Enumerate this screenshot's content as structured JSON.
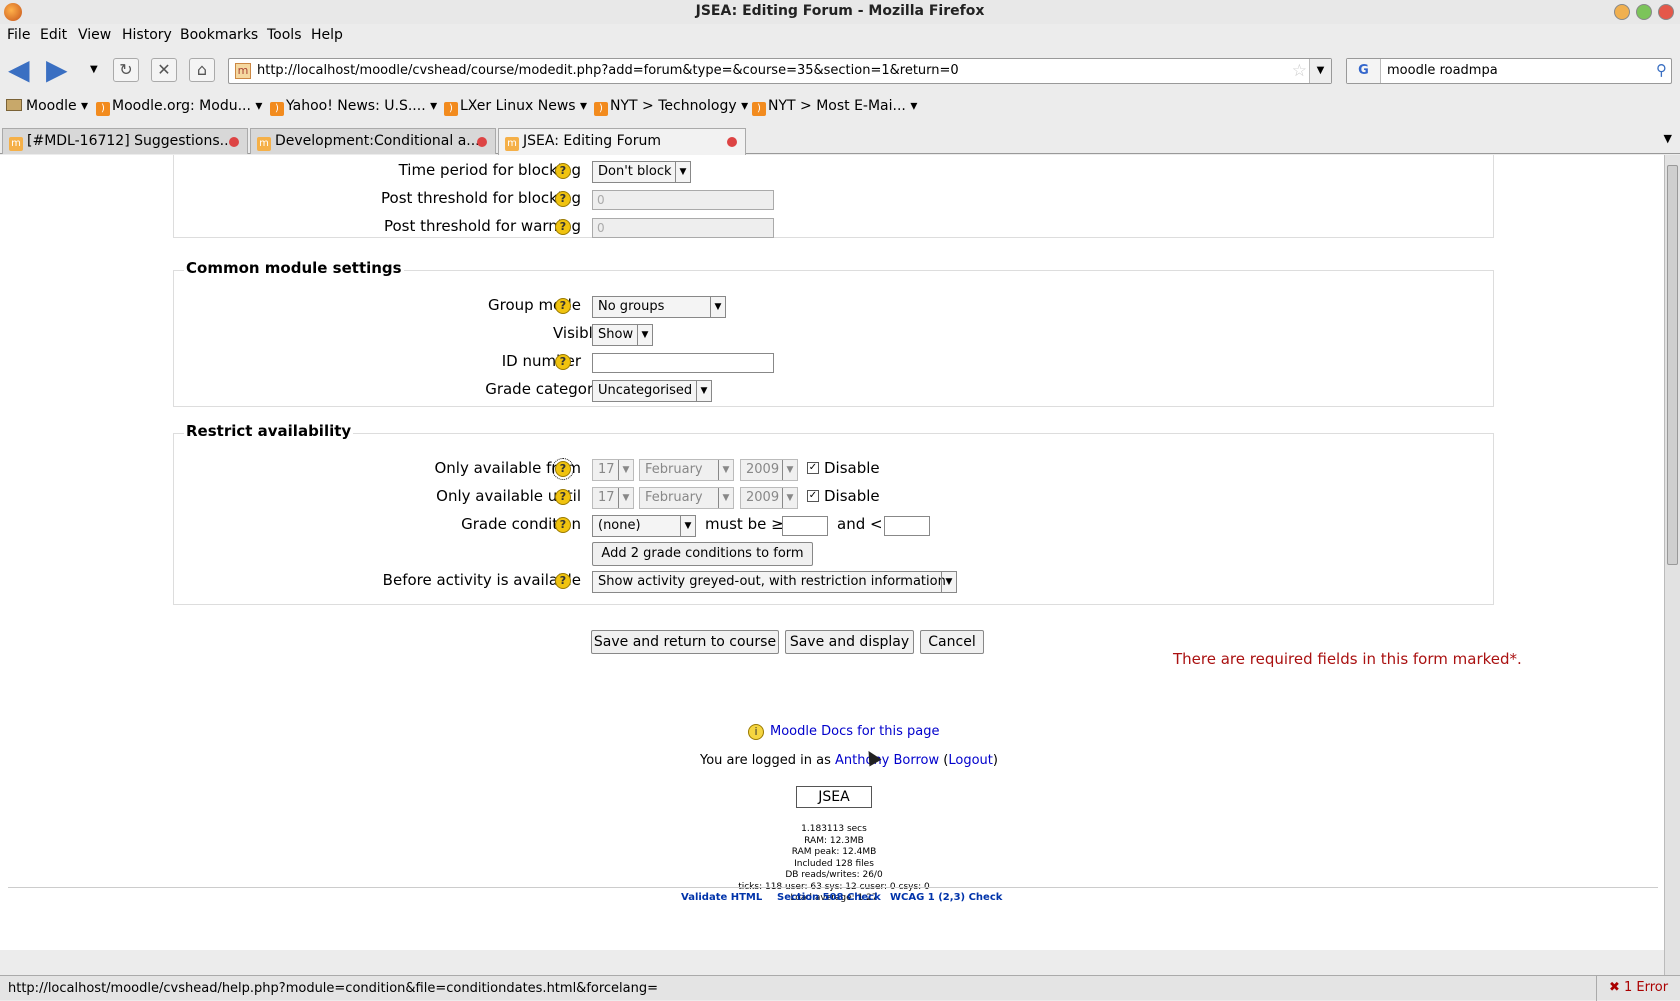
{
  "window": {
    "title": "JSEA: Editing Forum - Mozilla Firefox"
  },
  "menu": [
    "File",
    "Edit",
    "View",
    "History",
    "Bookmarks",
    "Tools",
    "Help"
  ],
  "url": "http://localhost/moodle/cvshead/course/modedit.php?add=forum&type=&course=35&section=1&return=0",
  "search": {
    "engine": "G",
    "value": "moodle roadmpa"
  },
  "bookmarks": [
    "Moodle",
    "Moodle.org: Modu...",
    "Yahoo! News: U.S....",
    "LXer Linux News",
    "NYT > Technology",
    "NYT > Most E-Mai..."
  ],
  "tabs": [
    {
      "label": "[#MDL-16712] Suggestions..."
    },
    {
      "label": "Development:Conditional a..."
    },
    {
      "label": "JSEA: Editing Forum"
    }
  ],
  "blocking": {
    "time_period_label": "Time period for blocking",
    "time_period_value": "Don't block",
    "post_threshold_block_label": "Post threshold for blocking",
    "post_threshold_block_value": "0",
    "post_threshold_warn_label": "Post threshold for warning",
    "post_threshold_warn_value": "0"
  },
  "common": {
    "legend": "Common module settings",
    "group_mode_label": "Group mode",
    "group_mode_value": "No groups",
    "visible_label": "Visible",
    "visible_value": "Show",
    "id_number_label": "ID number",
    "grade_category_label": "Grade category",
    "grade_category_value": "Uncategorised"
  },
  "restrict": {
    "legend": "Restrict availability",
    "from_label": "Only available from",
    "until_label": "Only available until",
    "day": "17",
    "month": "February",
    "year": "2009",
    "disable_label": "Disable",
    "grade_condition_label": "Grade condition",
    "grade_condition_value": "(none)",
    "must_be": "must be ≥",
    "and_lt": "and <",
    "add_conditions_button": "Add 2 grade conditions to form",
    "before_label": "Before activity is available",
    "before_value": "Show activity greyed-out, with restriction information"
  },
  "buttons": {
    "save_return": "Save and return to course",
    "save_display": "Save and display",
    "cancel": "Cancel"
  },
  "required_note": "There are required fields in this form marked*.",
  "footer": {
    "docs_link": "Moodle Docs for this page",
    "logged_in_prefix": "You are logged in as",
    "user_name": "Anthony Borrow",
    "logout": "Logout",
    "course_button": "JSEA",
    "perf": [
      "1.183113 secs",
      "RAM: 12.3MB",
      "RAM peak: 12.4MB",
      "Included 128 files",
      "DB reads/writes: 26/0",
      "ticks: 118 user: 63 sys: 12 cuser: 0 csys: 0",
      "Load average: 1.27"
    ],
    "validate_html": "Validate HTML",
    "section508": "Section 508 Check",
    "wcag": "WCAG 1 (2,3) Check"
  },
  "statusbar": {
    "text": "http://localhost/moodle/cvshead/help.php?module=condition&file=conditiondates.html&forcelang=",
    "errors": "1 Error"
  }
}
